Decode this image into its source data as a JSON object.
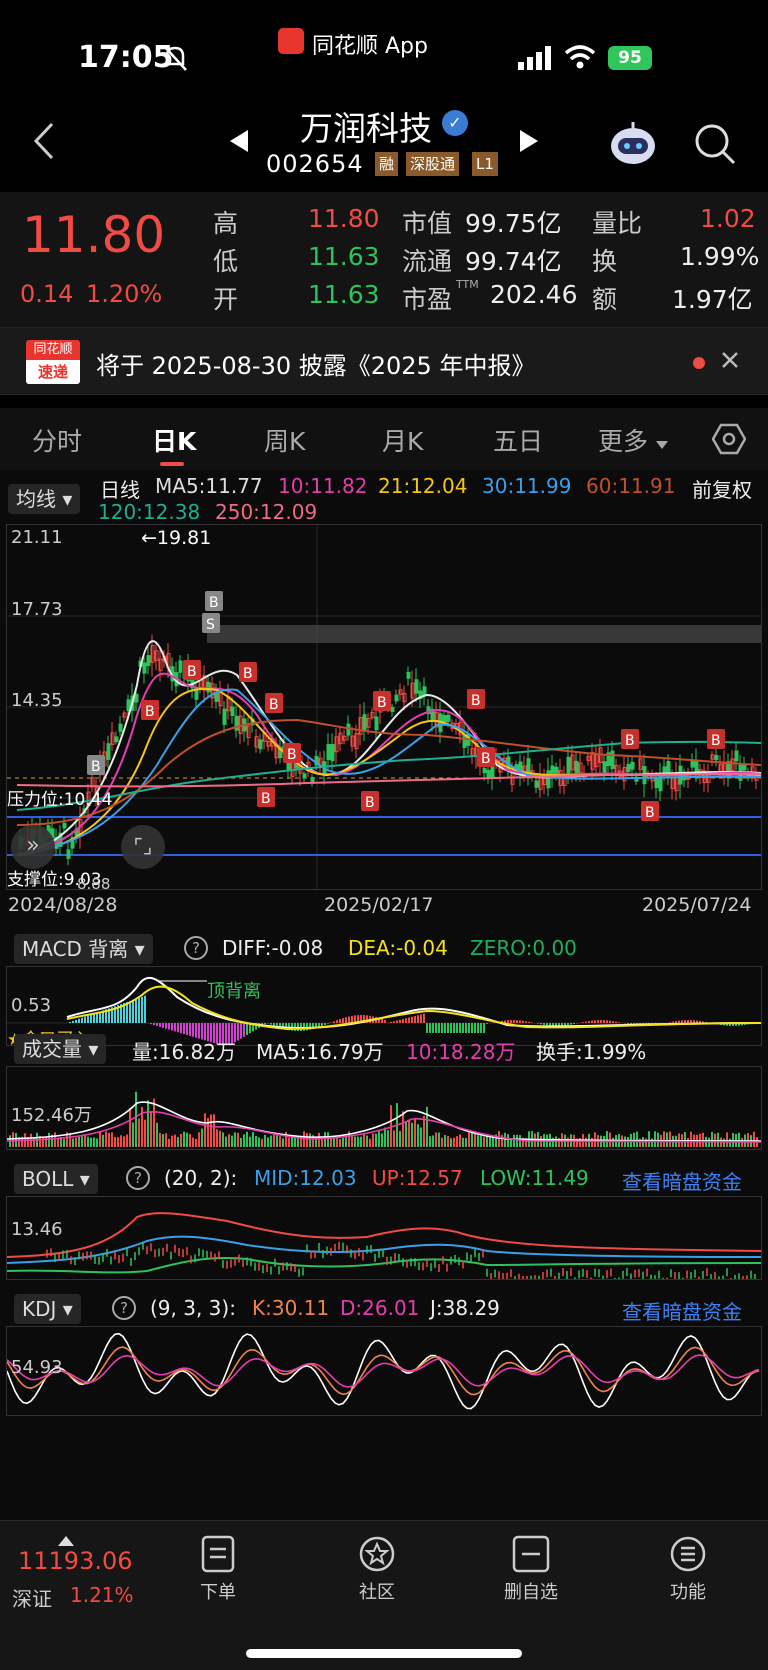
{
  "status": {
    "time": "17:05",
    "app": "同花顺 App",
    "battery": "95"
  },
  "header": {
    "name": "万润科技",
    "code": "002654",
    "badges": [
      "融",
      "深股通",
      "L1"
    ]
  },
  "quote": {
    "price": "11.80",
    "change": "0.14",
    "pct": "1.20%",
    "high_l": "高",
    "high": "11.80",
    "low_l": "低",
    "low": "11.63",
    "open_l": "开",
    "open": "11.63",
    "mcap_l": "市值",
    "mcap": "99.75亿",
    "float_l": "流通",
    "float": "99.74亿",
    "pe_l": "市盈",
    "pe_sup": "TTM",
    "pe": "202.46",
    "vr_l": "量比",
    "vr": "1.02",
    "turn_l": "换",
    "turn": "1.99%",
    "amt_l": "额",
    "amt": "1.97亿"
  },
  "notice": {
    "logo1": "同花顺",
    "logo2": "速递",
    "text": "将于 2025-08-30 披露《2025 年中报》"
  },
  "tabs": [
    "分时",
    "日K",
    "周K",
    "月K",
    "五日",
    "更多"
  ],
  "kline": {
    "dropdown": "均线",
    "title": "日线",
    "adjust": "前复权",
    "ma": [
      {
        "t": "MA5:11.77",
        "c": "#e8e8e8"
      },
      {
        "t": "10:11.82",
        "c": "#e23fae"
      },
      {
        "t": "21:12.04",
        "c": "#f5c518"
      },
      {
        "t": "30:11.99",
        "c": "#3ba0ea"
      },
      {
        "t": "60:11.91",
        "c": "#c0502a"
      },
      {
        "t": "120:12.38",
        "c": "#1fae8f"
      },
      {
        "t": "250:12.09",
        "c": "#f06a8a"
      }
    ],
    "y_top": "21.11",
    "y_mid1": "17.73",
    "y_mid2": "14.35",
    "peak": "←19.81",
    "resist": "压力位:10.44",
    "support": "支撑位:9.03",
    "low_mark": "8.88",
    "dates": [
      "2024/08/28",
      "2025/02/17",
      "2025/07/24"
    ]
  },
  "macd": {
    "dropdown": "MACD 背离",
    "diff": "DIFF:-0.08",
    "dea": "DEA:-0.04",
    "zero": "ZERO:0.00",
    "y": "0.53",
    "note": "顶背离",
    "cross": "★金叉买入"
  },
  "vol": {
    "dropdown": "成交量",
    "v": "量:16.82万",
    "ma5": "MA5:16.79万",
    "ma10": "10:18.28万",
    "turn": "换手:1.99%",
    "y": "152.46万"
  },
  "boll": {
    "dropdown": "BOLL",
    "param": "(20, 2):",
    "mid": "MID:12.03",
    "up": "UP:12.57",
    "low": "LOW:11.49",
    "link": "查看暗盘资金",
    "y": "13.46"
  },
  "kdj": {
    "dropdown": "KDJ",
    "param": "(9, 3, 3):",
    "k": "K:30.11",
    "d": "D:26.01",
    "j": "J:38.29",
    "link": "查看暗盘资金",
    "y": "54.93"
  },
  "bottom": {
    "index": "11193.06",
    "index_name": "深证",
    "index_pct": "1.21%",
    "order": "下单",
    "community": "社区",
    "remove": "删自选",
    "func": "功能"
  },
  "colors": {
    "up": "#f04b44",
    "down": "#2ec25c",
    "accent": "#3ba0ea"
  }
}
